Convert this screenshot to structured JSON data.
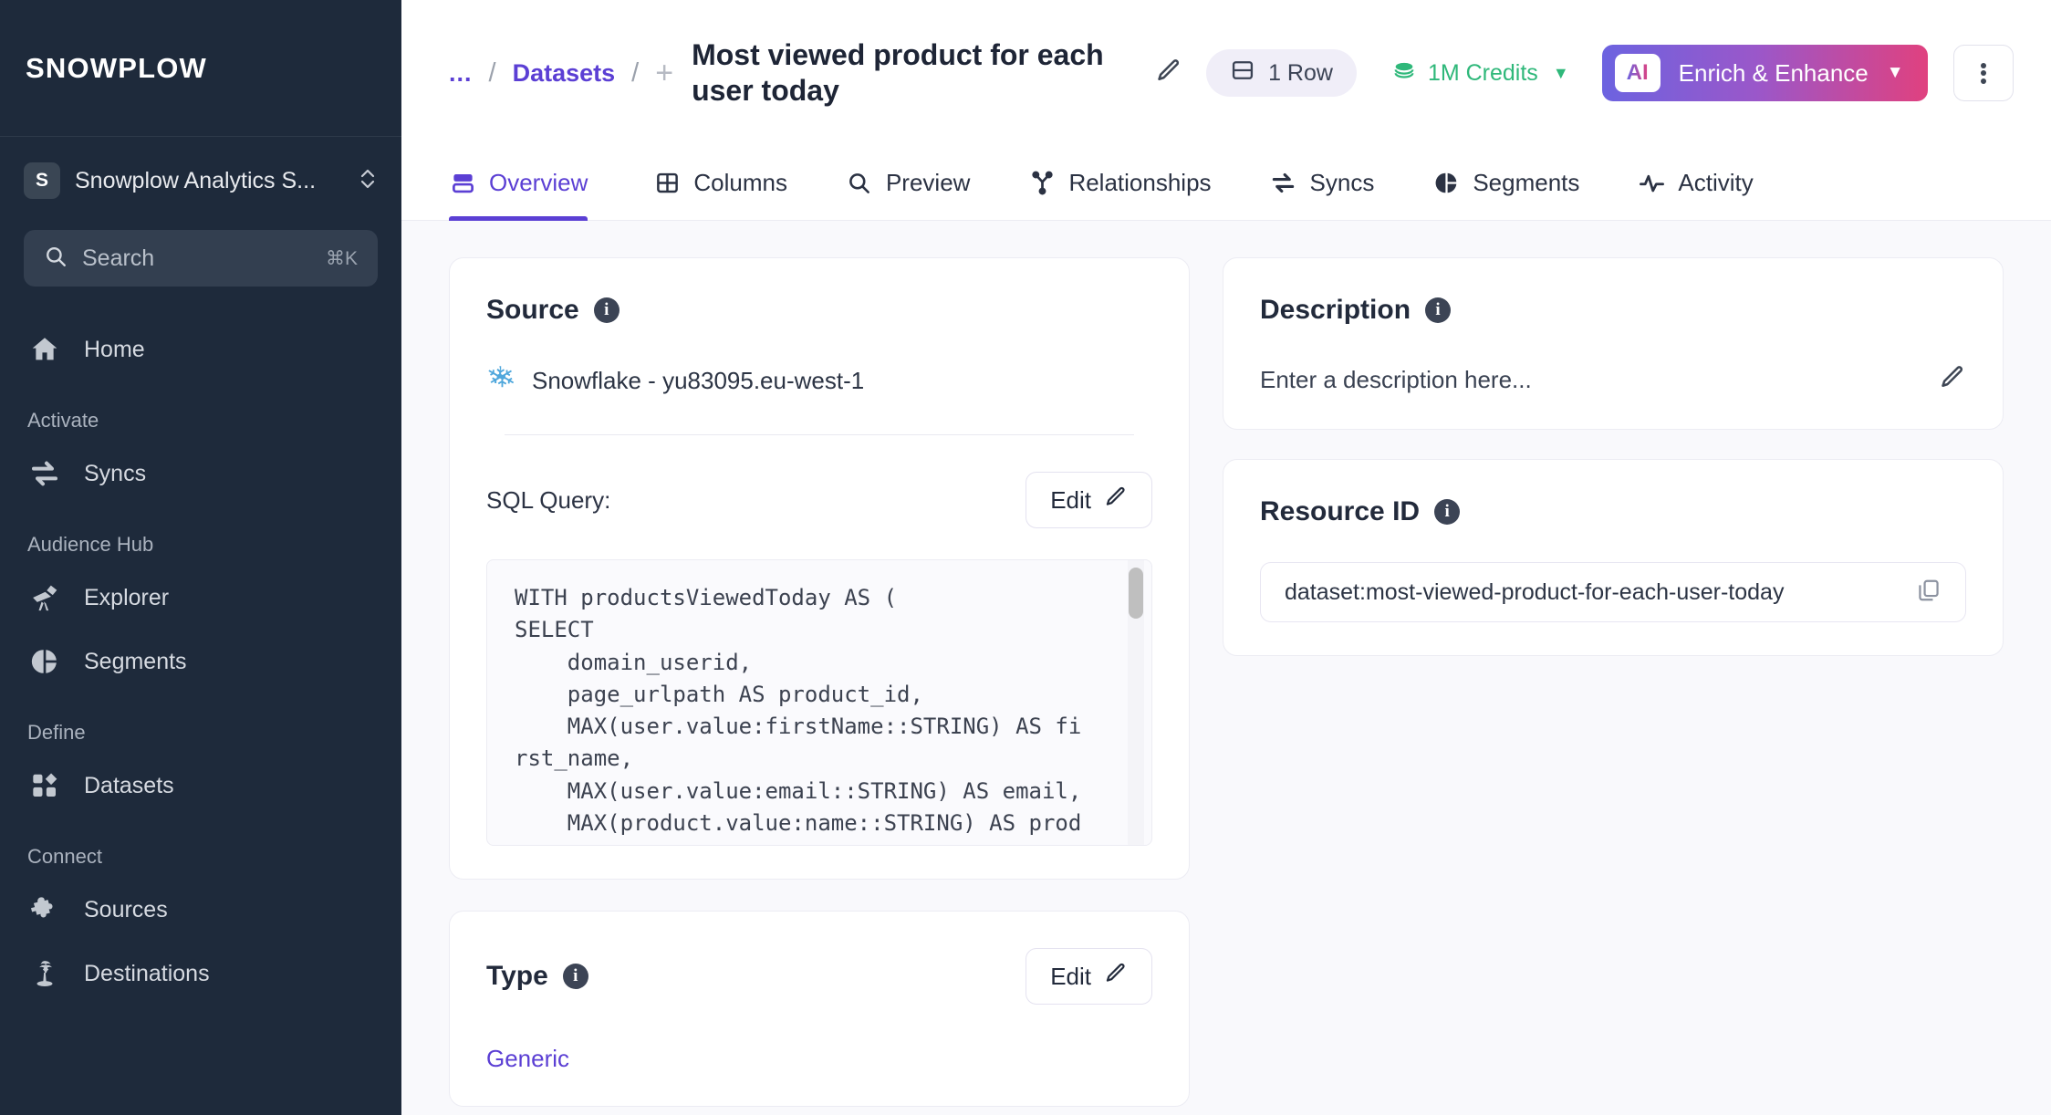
{
  "sidebar": {
    "brand": "SNOWPLOW",
    "org": {
      "initial": "S",
      "name": "Snowplow Analytics S...",
      "icon": "chevron-up-down-icon"
    },
    "search": {
      "placeholder": "Search",
      "shortcut": "⌘K",
      "icon": "search-icon"
    },
    "items": [
      {
        "label": "Home",
        "icon": "home-icon"
      }
    ],
    "groups": [
      {
        "title": "Activate",
        "items": [
          {
            "label": "Syncs",
            "icon": "syncs-arrows-icon"
          }
        ]
      },
      {
        "title": "Audience Hub",
        "items": [
          {
            "label": "Explorer",
            "icon": "telescope-icon"
          },
          {
            "label": "Segments",
            "icon": "pie-chart-icon"
          }
        ]
      },
      {
        "title": "Define",
        "items": [
          {
            "label": "Datasets",
            "icon": "grid-blocks-icon"
          }
        ]
      },
      {
        "title": "Connect",
        "items": [
          {
            "label": "Sources",
            "icon": "puzzle-piece-icon"
          },
          {
            "label": "Destinations",
            "icon": "palm-tree-icon"
          }
        ]
      }
    ]
  },
  "header": {
    "breadcrumb": {
      "ellipsis": "...",
      "separator": "/",
      "datasets": "Datasets",
      "plus": "+"
    },
    "title": "Most viewed product for each user today",
    "edit_title_icon": "pencil-icon",
    "row_badge": {
      "label": "1 Row",
      "icon": "rows-icon"
    },
    "credits": {
      "label": "1M Credits",
      "icon": "coins-icon",
      "caret": "▼",
      "color": "#2FB87A"
    },
    "ai_button": {
      "chip": "AI",
      "label": "Enrich & Enhance",
      "caret": "▼"
    },
    "kebab": "more-options-icon"
  },
  "tabs": [
    {
      "label": "Overview",
      "icon": "overview-rows-icon",
      "active": true
    },
    {
      "label": "Columns",
      "icon": "table-columns-icon",
      "active": false
    },
    {
      "label": "Preview",
      "icon": "magnifier-icon",
      "active": false
    },
    {
      "label": "Relationships",
      "icon": "relationships-icon",
      "active": false
    },
    {
      "label": "Syncs",
      "icon": "syncs-arrows-icon",
      "active": false
    },
    {
      "label": "Segments",
      "icon": "pie-chart-icon",
      "active": false
    },
    {
      "label": "Activity",
      "icon": "activity-pulse-icon",
      "active": false
    }
  ],
  "source_card": {
    "title": "Source",
    "info_icon": "info-icon",
    "connection": "Snowflake - yu83095.eu-west-1",
    "connection_icon": "snowflake-icon",
    "sql_label": "SQL Query:",
    "edit_label": "Edit",
    "edit_icon": "pencil-icon",
    "sql_code": "WITH productsViewedToday AS (\nSELECT\n    domain_userid,\n    page_urlpath AS product_id,\n    MAX(user.value:firstName::STRING) AS fi\nrst_name,\n    MAX(user.value:email::STRING) AS email,\n    MAX(product.value:name::STRING) AS prod\nuct,"
  },
  "type_card": {
    "title": "Type",
    "info_icon": "info-icon",
    "edit_label": "Edit",
    "edit_icon": "pencil-icon",
    "value": "Generic"
  },
  "description_card": {
    "title": "Description",
    "info_icon": "info-icon",
    "placeholder": "Enter a description here...",
    "edit_icon": "pencil-icon"
  },
  "resource_card": {
    "title": "Resource ID",
    "info_icon": "info-icon",
    "value": "dataset:most-viewed-product-for-each-user-today",
    "copy_icon": "copy-icon"
  },
  "colors": {
    "accent": "#5B3FD4",
    "sidebar_bg": "#1E2A3B",
    "page_bg": "#F9F9FC",
    "credits_green": "#2FB87A",
    "snowflake_blue": "#4FA7DC"
  }
}
